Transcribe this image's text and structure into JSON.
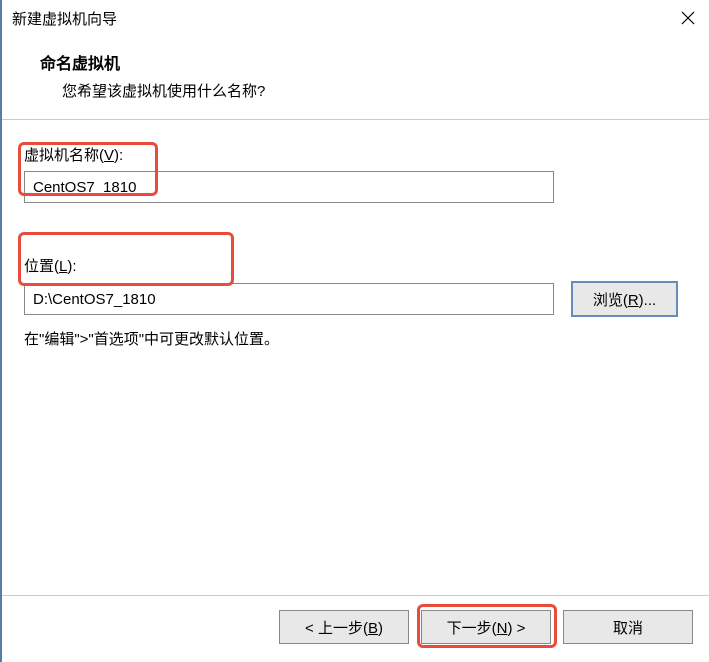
{
  "titlebar": {
    "title": "新建虚拟机向导"
  },
  "header": {
    "title": "命名虚拟机",
    "subtitle": "您希望该虚拟机使用什么名称?"
  },
  "fields": {
    "vm_name_label_pre": "虚拟机名称(",
    "vm_name_label_u": "V",
    "vm_name_label_post": "):",
    "vm_name_value": "CentOS7_1810",
    "location_label_pre": "位置(",
    "location_label_u": "L",
    "location_label_post": "):",
    "location_value": "D:\\CentOS7_1810",
    "browse_pre": "浏览(",
    "browse_u": "R",
    "browse_post": ")...",
    "hint": "在\"编辑\">\"首选项\"中可更改默认位置。"
  },
  "footer": {
    "back_pre": "< 上一步(",
    "back_u": "B",
    "back_post": ")",
    "next_pre": "下一步(",
    "next_u": "N",
    "next_post": ") >",
    "cancel": "取消"
  }
}
